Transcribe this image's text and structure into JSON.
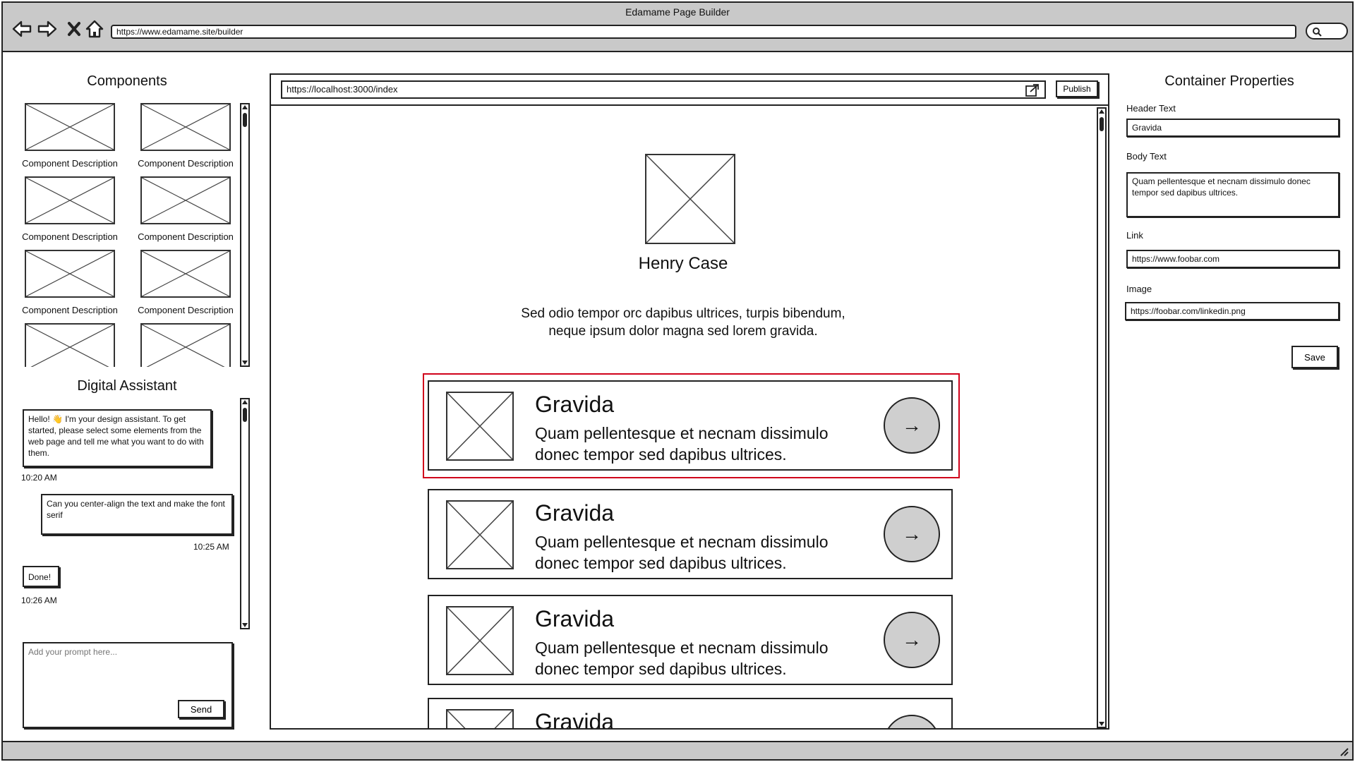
{
  "window": {
    "title": "Edamame Page Builder",
    "url": "https://www.edamame.site/builder"
  },
  "components": {
    "title": "Components",
    "items": [
      {
        "description": "Component Description"
      },
      {
        "description": "Component Description"
      },
      {
        "description": "Component Description"
      },
      {
        "description": "Component Description"
      },
      {
        "description": "Component Description"
      },
      {
        "description": "Component Description"
      },
      {
        "description": ""
      },
      {
        "description": ""
      }
    ]
  },
  "assistant": {
    "title": "Digital Assistant",
    "messages": [
      {
        "text": "Hello! 👋 I'm your design assistant. To get started, please select some elements from the web page and tell me what you want to do with them.",
        "time": "10:20 AM"
      },
      {
        "text": "Can you center-align the text and make the font serif",
        "time": "10:25 AM"
      },
      {
        "text": "Done!",
        "time": "10:26 AM"
      }
    ],
    "prompt_placeholder": "Add your prompt here...",
    "send_label": "Send"
  },
  "canvas": {
    "url": "https://localhost:3000/index",
    "publish_label": "Publish",
    "profile_name": "Henry Case",
    "bio_line1": "Sed odio tempor orc dapibus ultrices, turpis bibendum,",
    "bio_line2": "neque ipsum dolor magna sed lorem gravida.",
    "cards": [
      {
        "title": "Gravida",
        "body_line1": "Quam pellentesque et necnam dissimulo",
        "body_line2": "donec tempor sed dapibus ultrices.",
        "selected": true
      },
      {
        "title": "Gravida",
        "body_line1": "Quam pellentesque et necnam dissimulo",
        "body_line2": "donec tempor sed dapibus ultrices.",
        "selected": false
      },
      {
        "title": "Gravida",
        "body_line1": "Quam pellentesque et necnam dissimulo",
        "body_line2": "donec tempor sed dapibus ultrices.",
        "selected": false
      },
      {
        "title": "Gravida",
        "body_line1": "",
        "body_line2": "",
        "selected": false
      }
    ],
    "arrow_glyph": "→"
  },
  "properties": {
    "title": "Container Properties",
    "header_text_label": "Header Text",
    "header_text_value": "Gravida",
    "body_text_label": "Body Text",
    "body_text_value": "Quam pellentesque et necnam dissimulo donec tempor sed dapibus ultrices.",
    "link_label": "Link",
    "link_value": "https://www.foobar.com",
    "image_label": "Image",
    "image_value": "https://foobar.com/linkedin.png",
    "save_label": "Save"
  },
  "colors": {
    "selection": "#d0021b",
    "chrome": "#c9c9c9",
    "arrow_button": "#cfcfcf"
  }
}
